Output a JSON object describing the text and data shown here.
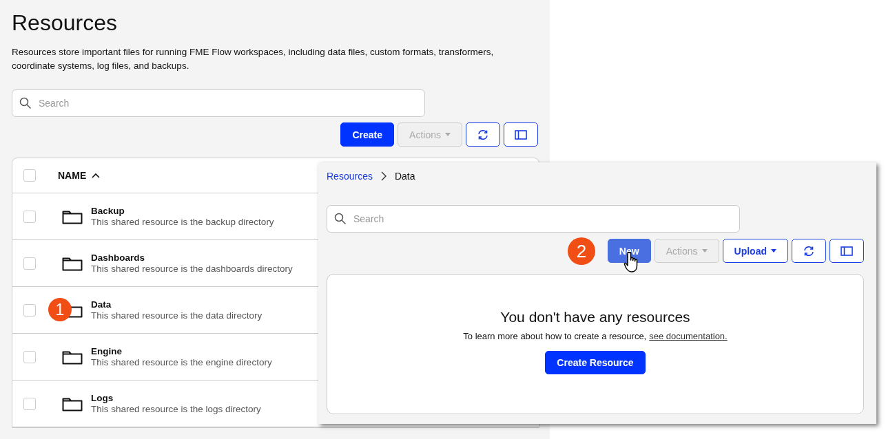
{
  "page": {
    "title": "Resources",
    "description": "Resources store important files for running FME Flow workspaces, including data files, custom formats, transformers, coordinate systems, log files, and backups.",
    "search": {
      "placeholder": "Search"
    },
    "toolbar": [
      {
        "kind": "primary",
        "label": "Create",
        "disabled": false,
        "hovered": false
      },
      {
        "kind": "menu",
        "label": "Actions",
        "disabled": true,
        "hovered": false
      },
      {
        "kind": "refresh",
        "disabled": false,
        "hovered": false
      },
      {
        "kind": "panel",
        "disabled": false,
        "hovered": false
      }
    ],
    "table": {
      "header": {
        "checked": false,
        "label": "NAME",
        "sorted_ascending": true
      },
      "rows": [
        {
          "name": "Backup",
          "description": "This shared resource is the backup directory",
          "checked": false
        },
        {
          "name": "Dashboards",
          "description": "This shared resource is the dashboards directory",
          "checked": false
        },
        {
          "name": "Data",
          "description": "This shared resource is the data directory",
          "checked": false,
          "callout": "1"
        },
        {
          "name": "Engine",
          "description": "This shared resource is the engine directory",
          "checked": false
        },
        {
          "name": "Logs",
          "description": "This shared resource is the logs directory",
          "checked": false
        }
      ]
    }
  },
  "overlay": {
    "breadcrumb": [
      {
        "label": "Resources",
        "link": true
      },
      {
        "label": "Data",
        "link": false
      }
    ],
    "search": {
      "placeholder": "Search"
    },
    "callout": "2",
    "toolbar": [
      {
        "kind": "primary",
        "label": "New",
        "disabled": false,
        "hovered": true
      },
      {
        "kind": "menu",
        "label": "Actions",
        "disabled": true,
        "hovered": false
      },
      {
        "kind": "menu",
        "label": "Upload",
        "disabled": false,
        "hovered": false
      },
      {
        "kind": "refresh",
        "disabled": false,
        "hovered": false
      },
      {
        "kind": "panel",
        "disabled": false,
        "hovered": false
      }
    ],
    "empty": {
      "heading": "You don't have any resources",
      "text": "To learn more about how to create a resource,",
      "link": "see documentation.",
      "button": "Create Resource"
    }
  }
}
